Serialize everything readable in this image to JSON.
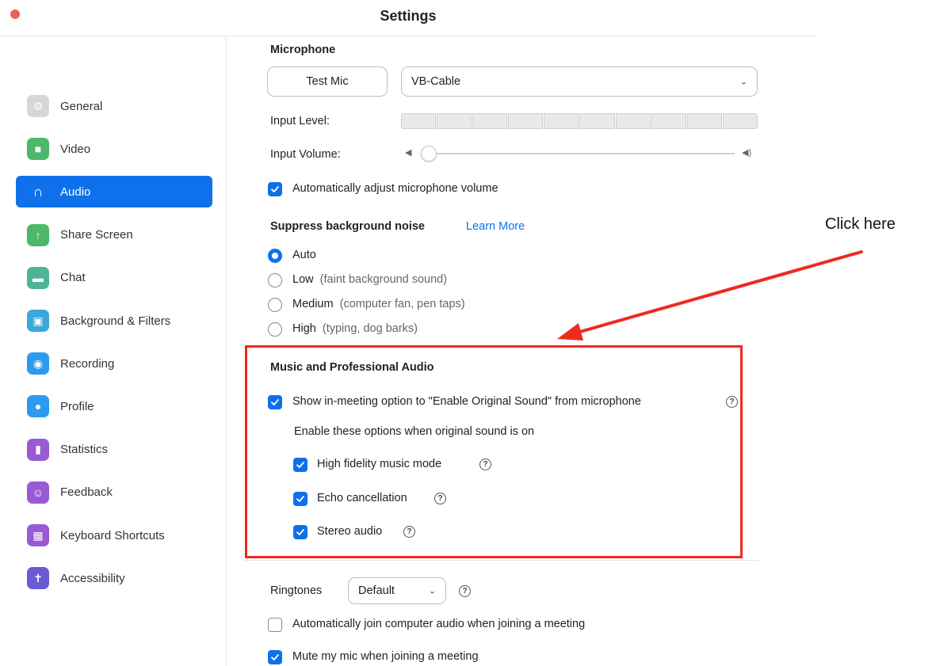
{
  "window": {
    "title": "Settings"
  },
  "sidebar": {
    "items": [
      {
        "label": "General",
        "icon": "gear-icon",
        "color": "#d7d7d7",
        "glyph": "⚙",
        "active": false
      },
      {
        "label": "Video",
        "icon": "video-camera-icon",
        "color": "#4cb869",
        "glyph": "■",
        "active": false
      },
      {
        "label": "Audio",
        "icon": "headphones-icon",
        "color": "#0e71eb",
        "glyph": "∩",
        "active": true
      },
      {
        "label": "Share Screen",
        "icon": "share-screen-icon",
        "color": "#4cb869",
        "glyph": "↑",
        "active": false
      },
      {
        "label": "Chat",
        "icon": "chat-bubble-icon",
        "color": "#4db49a",
        "glyph": "▬",
        "active": false
      },
      {
        "label": "Background & Filters",
        "icon": "person-card-icon",
        "color": "#3aa8d8",
        "glyph": "▣",
        "active": false
      },
      {
        "label": "Recording",
        "icon": "record-icon",
        "color": "#2b9bf0",
        "glyph": "◉",
        "active": false
      },
      {
        "label": "Profile",
        "icon": "profile-icon",
        "color": "#2b9bf0",
        "glyph": "●",
        "active": false
      },
      {
        "label": "Statistics",
        "icon": "bar-chart-icon",
        "color": "#9a5ad6",
        "glyph": "▮",
        "active": false
      },
      {
        "label": "Feedback",
        "icon": "smiley-icon",
        "color": "#9a5ad6",
        "glyph": "☺",
        "active": false
      },
      {
        "label": "Keyboard Shortcuts",
        "icon": "keyboard-icon",
        "color": "#9a5ad6",
        "glyph": "▦",
        "active": false
      },
      {
        "label": "Accessibility",
        "icon": "accessibility-icon",
        "color": "#6a5ad6",
        "glyph": "✝",
        "active": false
      }
    ]
  },
  "microphone": {
    "title": "Microphone",
    "test_button": "Test Mic",
    "device": "VB-Cable",
    "input_level_label": "Input Level:",
    "input_level_segments": 10,
    "input_volume_label": "Input Volume:",
    "input_volume_value": 0,
    "auto_adjust_label": "Automatically adjust microphone volume",
    "auto_adjust_checked": true
  },
  "noise": {
    "title": "Suppress background noise",
    "learn_more": "Learn More",
    "options": [
      {
        "label": "Auto",
        "hint": "",
        "selected": true
      },
      {
        "label": "Low",
        "hint": "(faint background sound)",
        "selected": false
      },
      {
        "label": "Medium",
        "hint": "(computer fan, pen taps)",
        "selected": false
      },
      {
        "label": "High",
        "hint": "(typing, dog barks)",
        "selected": false
      }
    ]
  },
  "music": {
    "title": "Music and Professional Audio",
    "show_original_sound_label": "Show in-meeting option to \"Enable Original Sound\" from microphone",
    "show_original_sound_checked": true,
    "sub_heading": "Enable these options when original sound is on",
    "options": [
      {
        "label": "High fidelity music mode",
        "checked": true
      },
      {
        "label": "Echo cancellation",
        "checked": true
      },
      {
        "label": "Stereo audio",
        "checked": true
      }
    ]
  },
  "ringtones": {
    "label": "Ringtones",
    "value": "Default"
  },
  "other": {
    "auto_join_label": "Automatically join computer audio when joining a meeting",
    "auto_join_checked": false,
    "mute_label": "Mute my mic when joining a meeting",
    "mute_checked": true
  },
  "annotation": {
    "text": "Click here",
    "color": "#ee2b1d"
  }
}
